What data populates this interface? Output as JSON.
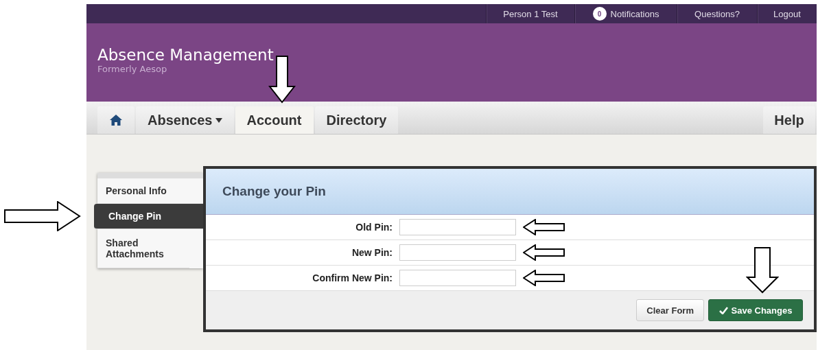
{
  "top_bar": {
    "items": [
      {
        "kind": "text",
        "label": "Person 1 Test"
      },
      {
        "kind": "notifications",
        "count": "0",
        "label": "Notifications"
      },
      {
        "kind": "text",
        "label": "Questions?"
      },
      {
        "kind": "text",
        "label": "Logout"
      }
    ]
  },
  "header": {
    "title": "Absence Management",
    "subtitle": "Formerly Aesop"
  },
  "nav": {
    "tabs": [
      {
        "kind": "home",
        "selected": false,
        "marked": false
      },
      {
        "kind": "dropdown",
        "label": "Absences",
        "selected": false,
        "marked": false
      },
      {
        "kind": "text",
        "label": "Account",
        "selected": true,
        "marked": true
      },
      {
        "kind": "text",
        "label": "Directory",
        "selected": false,
        "marked": false
      }
    ],
    "help": "Help"
  },
  "sidebar": {
    "items": [
      {
        "label": "Personal Info",
        "selected": false,
        "marked": false
      },
      {
        "label": "Change Pin",
        "selected": true,
        "marked": true
      },
      {
        "label": "Shared Attachments",
        "selected": false,
        "marked": false
      }
    ]
  },
  "panel": {
    "title": "Change your Pin",
    "fields": [
      {
        "label": "Old Pin:",
        "marked": true
      },
      {
        "label": "New Pin:",
        "marked": true
      },
      {
        "label": "Confirm New Pin:",
        "marked": true
      }
    ],
    "buttons": [
      {
        "kind": "default",
        "label": "Clear Form",
        "marked": false
      },
      {
        "kind": "primary",
        "label": "Save Changes",
        "marked": true
      }
    ]
  }
}
